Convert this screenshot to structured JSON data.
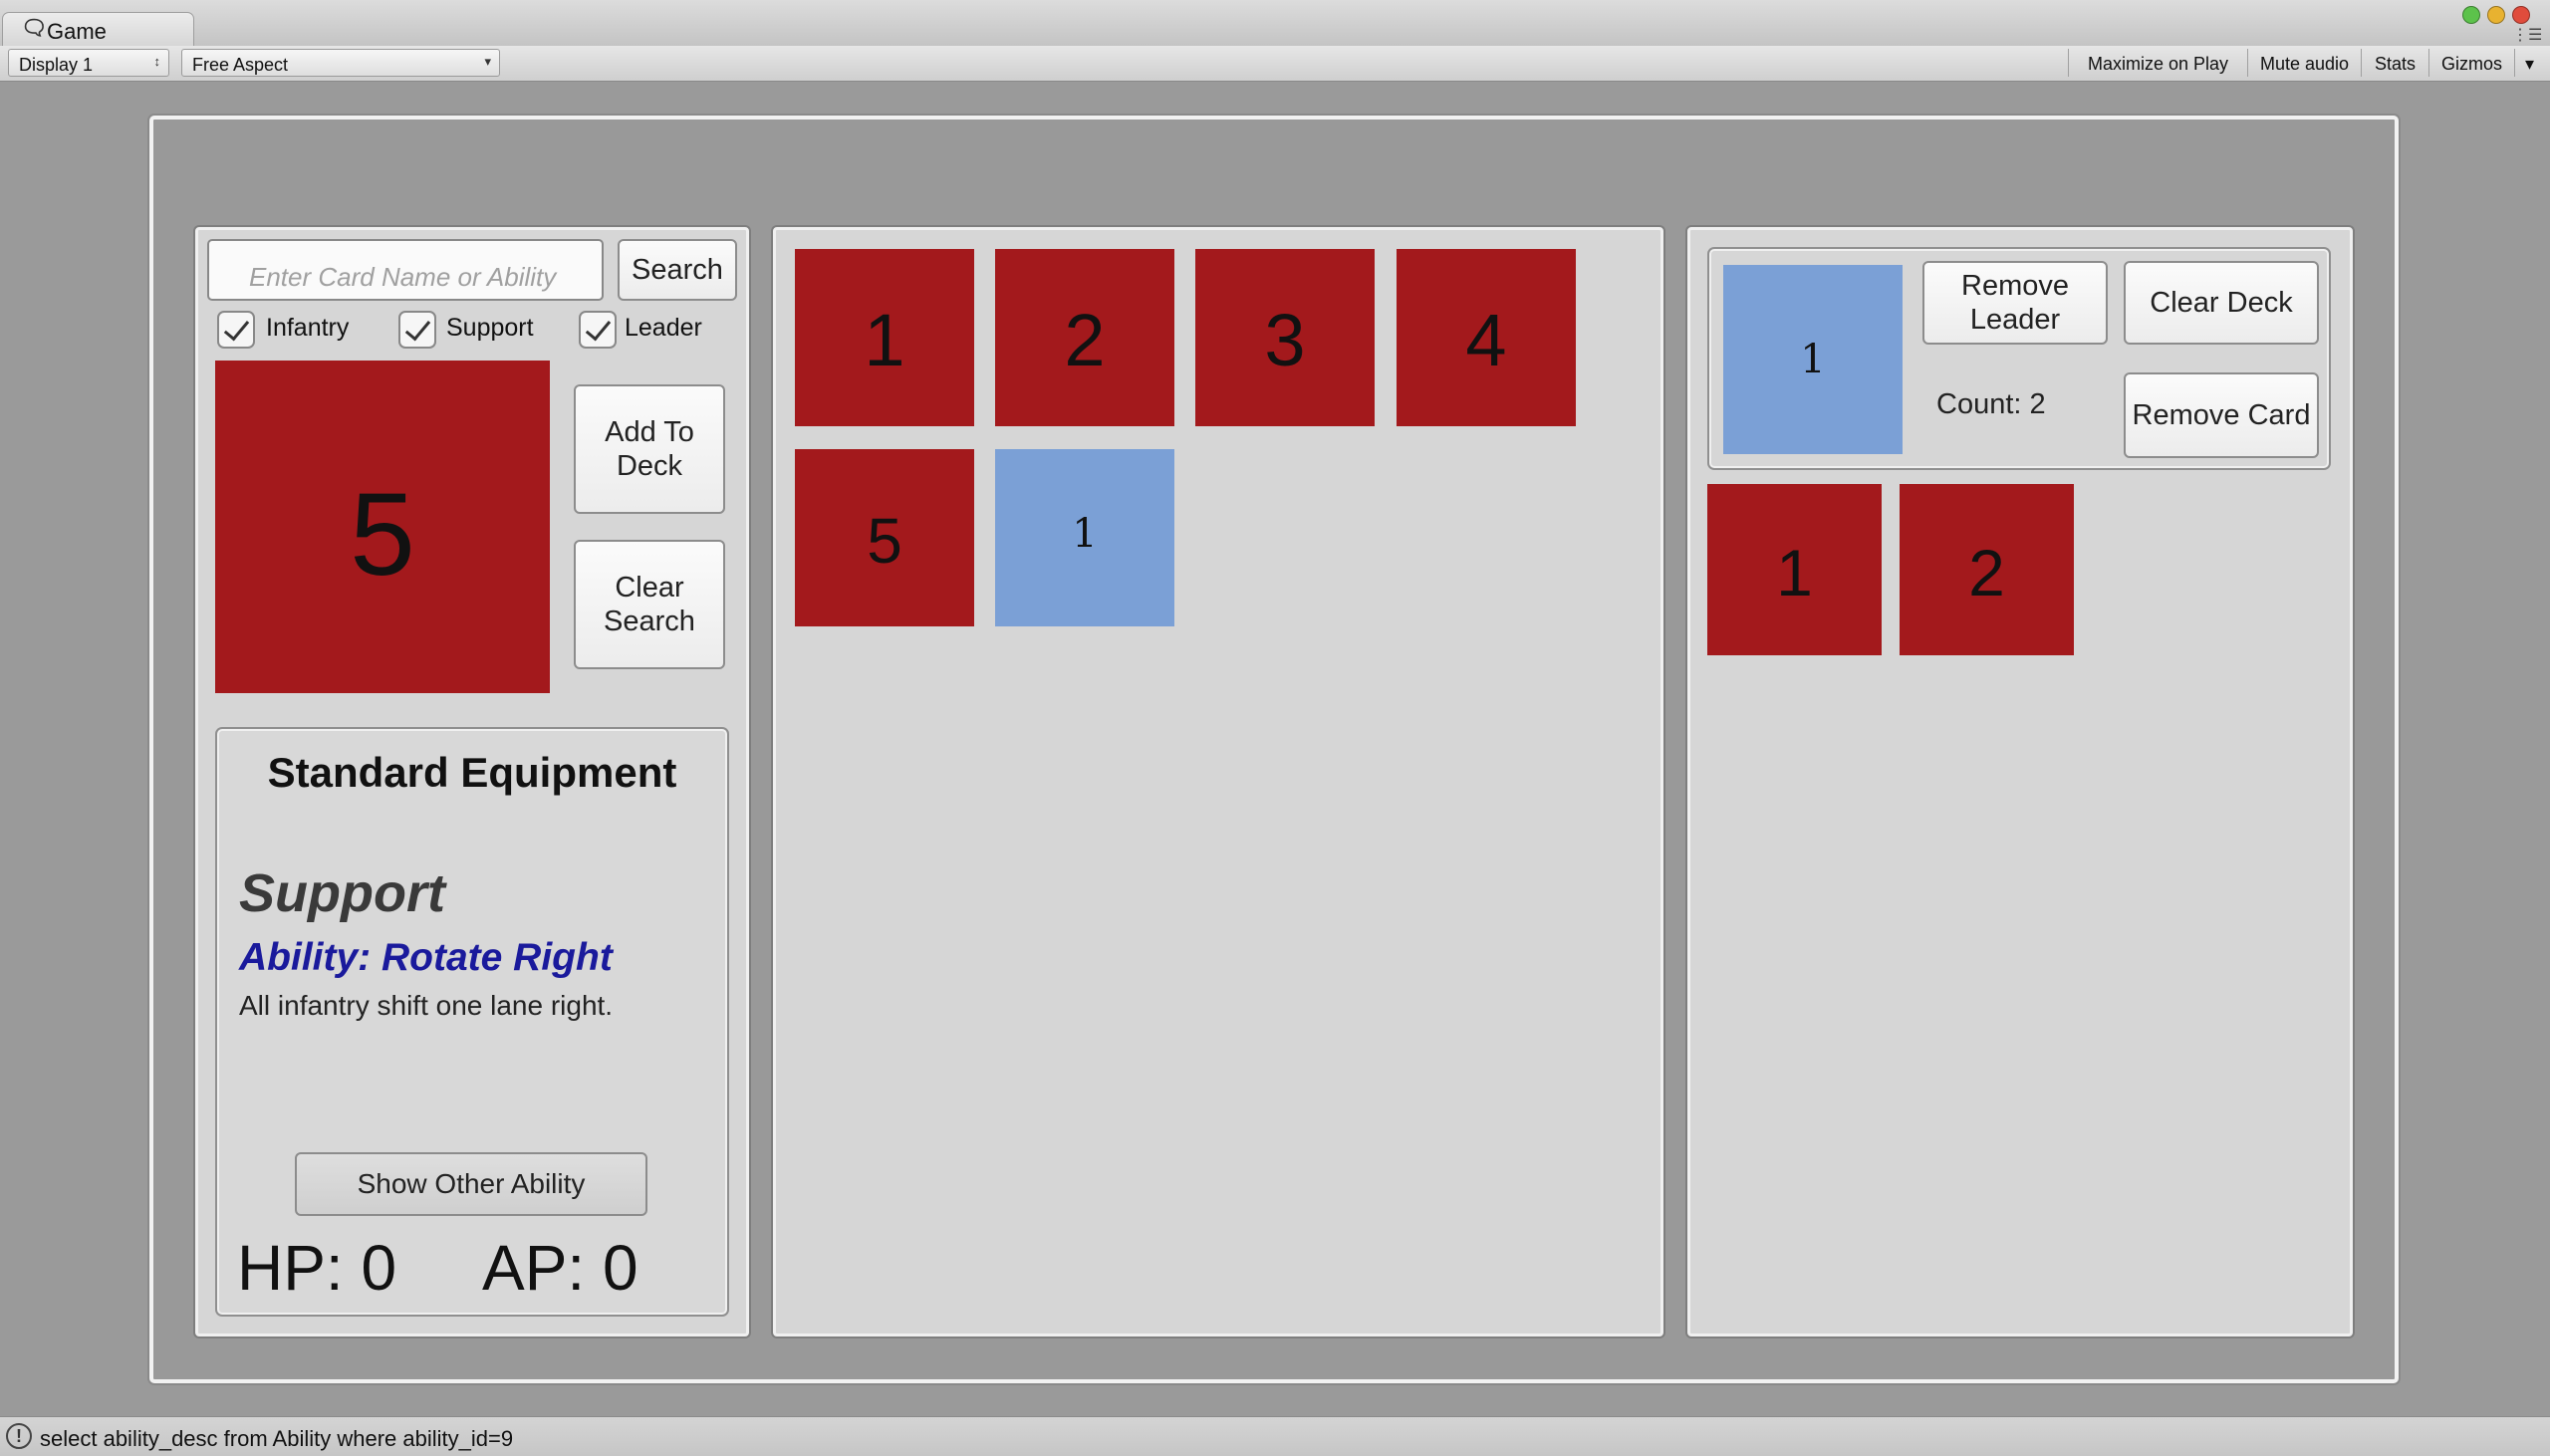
{
  "window": {
    "tab_label": "Game",
    "tab_icon": "unity-game-icon"
  },
  "toolbar": {
    "display": "Display 1",
    "aspect": "Free Aspect",
    "maximize": "Maximize on Play",
    "mute": "Mute audio",
    "stats": "Stats",
    "gizmos": "Gizmos"
  },
  "search": {
    "placeholder": "Enter Card Name or Ability",
    "button": "Search"
  },
  "filters": [
    {
      "label": "Infantry",
      "checked": true
    },
    {
      "label": "Support",
      "checked": true
    },
    {
      "label": "Leader",
      "checked": true
    }
  ],
  "preview_card": {
    "number": "5",
    "color": "#a3191c"
  },
  "actions": {
    "add_to_deck": "Add To Deck",
    "clear_search": "Clear Search"
  },
  "details": {
    "name": "Standard Equipment",
    "type": "Support",
    "ability": "Ability: Rotate Right",
    "description": "All infantry shift one lane right.",
    "show_other": "Show Other Ability",
    "hp": "HP: 0",
    "ap": "AP: 0"
  },
  "collection": [
    {
      "number": "1",
      "kind": "red"
    },
    {
      "number": "2",
      "kind": "red"
    },
    {
      "number": "3",
      "kind": "red"
    },
    {
      "number": "4",
      "kind": "red"
    },
    {
      "number": "5",
      "kind": "red"
    },
    {
      "number": "1",
      "kind": "blue"
    }
  ],
  "deck": {
    "leader": "1",
    "remove_leader": "Remove Leader",
    "clear_deck": "Clear Deck",
    "count": "Count: 2",
    "remove_card": "Remove Card",
    "cards": [
      "1",
      "2"
    ]
  },
  "colors": {
    "card_red": "#a3191c",
    "card_blue": "#7ba0d6",
    "ability_blue": "#1a1a9c"
  },
  "status_bar": {
    "icon": "warning-icon",
    "message": "select ability_desc from Ability where ability_id=9"
  }
}
